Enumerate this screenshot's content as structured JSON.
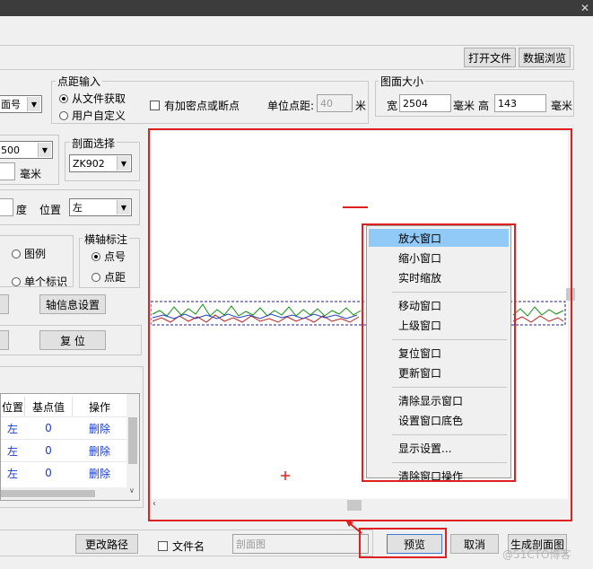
{
  "toolbar": {
    "open_file": "打开文件",
    "data_browse": "数据浏览"
  },
  "point_input": {
    "title": "点距输入",
    "from_file": "从文件获取",
    "user_defined": "用户自定义",
    "has_encrypted": "有加密点或断点",
    "unit_distance_label": "单位点距:",
    "unit_distance_value": "40",
    "unit_m": "米"
  },
  "section_no": "面号",
  "figure_size": {
    "title": "图面大小",
    "width_label": "宽",
    "width_value": "2504",
    "unit_mm": "毫米",
    "height_label": "高",
    "height_value": "143"
  },
  "left_inputs": {
    "value_500": "500",
    "unit_mm": "毫米",
    "unit_deg": "度",
    "position_label": "位置",
    "position_value": "左"
  },
  "section_select": {
    "title": "剖面选择",
    "value": "ZK902"
  },
  "legend_radio": "图例",
  "single_mark_radio": "单个标识",
  "x_axis_label": {
    "title": "横轴标注",
    "point_no": "点号",
    "point_dist": "点距"
  },
  "axis_settings": "轴信息设置",
  "reset": "复  位",
  "table": {
    "headers": [
      "位置",
      "基点值",
      "操作"
    ],
    "rows": [
      {
        "pos": "左",
        "base": "0",
        "op": "删除"
      },
      {
        "pos": "左",
        "base": "0",
        "op": "删除"
      },
      {
        "pos": "左",
        "base": "0",
        "op": "删除"
      }
    ]
  },
  "bottom": {
    "change_path": "更改路径",
    "file_name": "文件名",
    "filename_placeholder": "剖面图",
    "preview": "预览",
    "cancel": "取消",
    "generate": "生成剖面图"
  },
  "context_menu": [
    {
      "label": "放大窗口",
      "highlight": true
    },
    {
      "label": "缩小窗口"
    },
    {
      "label": "实时缩放"
    },
    {
      "sep": true
    },
    {
      "label": "移动窗口"
    },
    {
      "label": "上级窗口"
    },
    {
      "sep": true
    },
    {
      "label": "复位窗口"
    },
    {
      "label": "更新窗口"
    },
    {
      "sep": true
    },
    {
      "label": "清除显示窗口"
    },
    {
      "label": "设置窗口底色"
    },
    {
      "sep": true
    },
    {
      "label": "显示设置..."
    },
    {
      "sep": true
    },
    {
      "label": "清除窗口操作"
    }
  ],
  "watermark": "@51CTO博客",
  "colors": {
    "annotation_red": "#e02020",
    "menu_highlight": "#91c9f7"
  }
}
